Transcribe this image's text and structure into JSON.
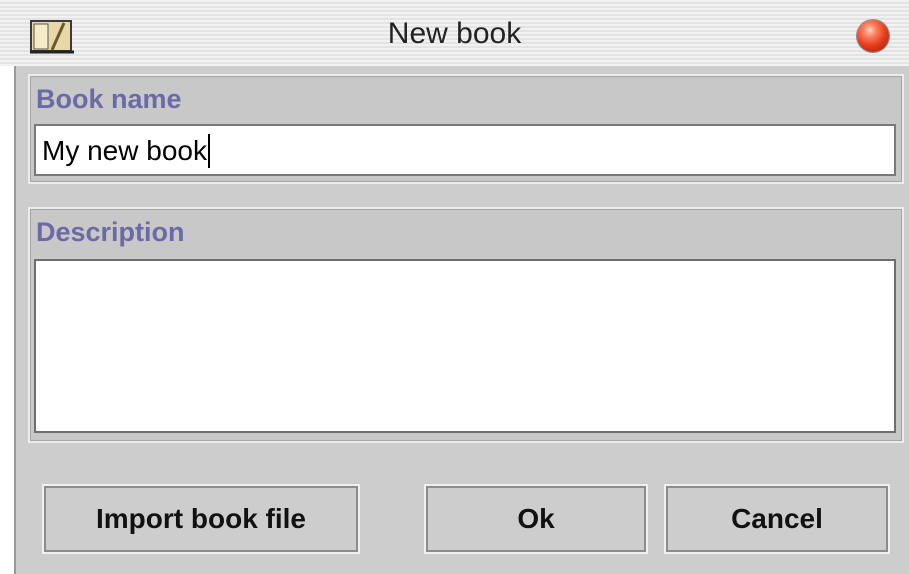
{
  "window": {
    "title": "New book",
    "icon": "book-icon",
    "close_icon": "close-icon"
  },
  "book_name": {
    "label": "Book name",
    "value": "My new book"
  },
  "description": {
    "label": "Description",
    "value": ""
  },
  "buttons": {
    "import": "Import book file",
    "ok": "Ok",
    "cancel": "Cancel"
  },
  "colors": {
    "label_accent": "#6a6aa6",
    "panel_bg": "#cdcdcd",
    "close_button": "#e23a1c"
  }
}
